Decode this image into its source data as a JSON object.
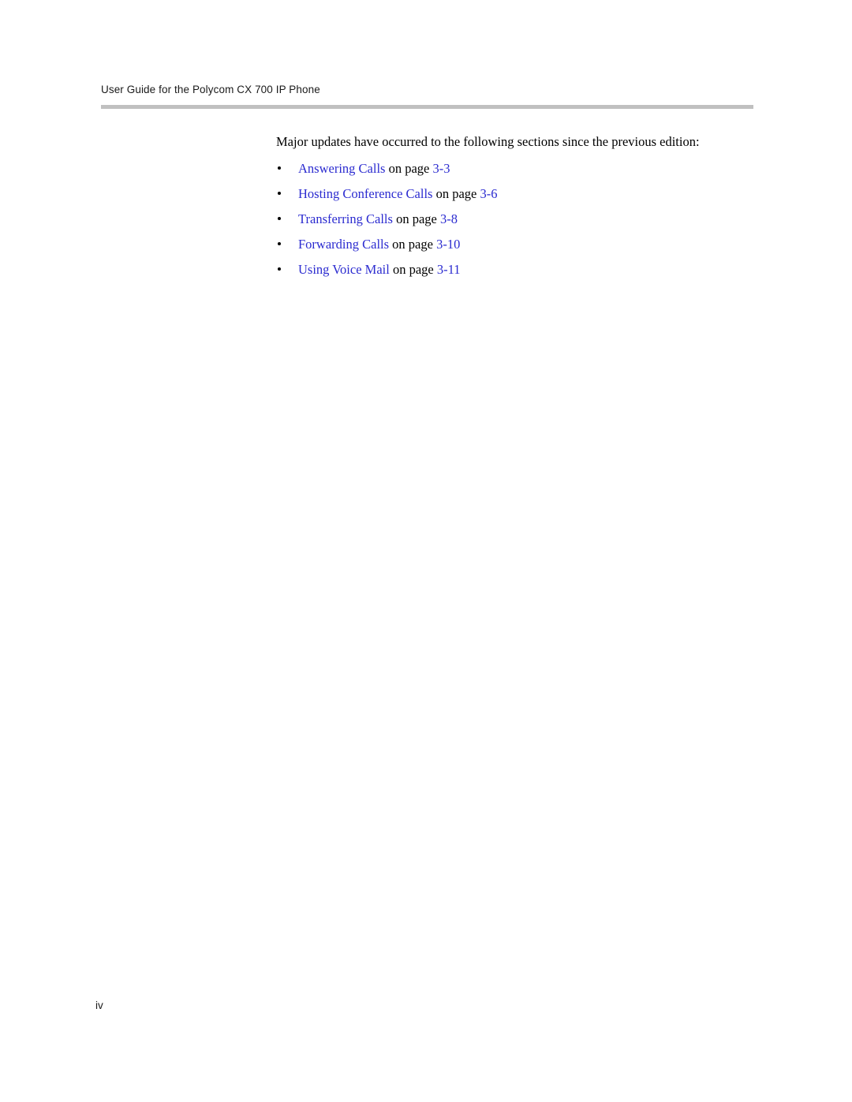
{
  "document": {
    "running_header": "User Guide for the Polycom CX 700 IP Phone",
    "folio": "iv"
  },
  "body": {
    "intro_paragraph": "Major updates have occurred to the following sections since the previous edition:",
    "connector_text": "on page",
    "items": [
      {
        "title": "Answering Calls",
        "connector": "on page",
        "page_ref": "3-3"
      },
      {
        "title": "Hosting Conference Calls",
        "connector": "on page",
        "page_ref": "3-6"
      },
      {
        "title": "Transferring Calls",
        "connector": "on page",
        "page_ref": "3-8"
      },
      {
        "title": "Forwarding Calls",
        "connector": "on page",
        "page_ref": "3-10"
      },
      {
        "title": "Using Voice Mail",
        "connector": "on page",
        "page_ref": "3-11"
      }
    ]
  },
  "style": {
    "link_color": "#2b2bd0",
    "rule_color": "#c0c0c0",
    "text_color": "#000000",
    "header_color": "#1a1a1a",
    "page_background": "#ffffff"
  }
}
